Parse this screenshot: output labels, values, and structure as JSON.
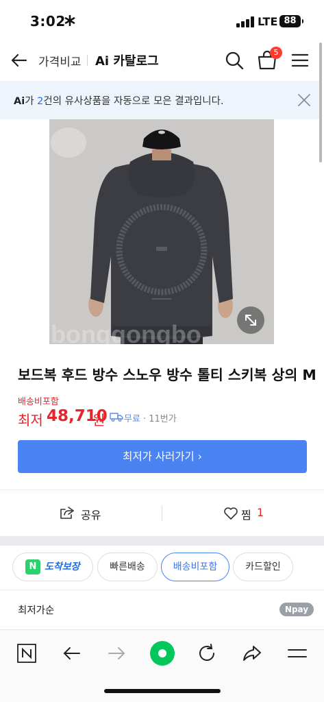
{
  "status_bar": {
    "time": "3:02",
    "network": "LTE",
    "battery": "88"
  },
  "nav": {
    "compare_label": "가격비교",
    "catalog_label": "Ai 카탈로그",
    "cart_count": "5"
  },
  "notice": {
    "ai": "Ai",
    "text_1": "가 ",
    "count": "2",
    "text_2": "건의 유사상품을 자동으로 모은 결과입니다."
  },
  "product": {
    "title": "보드복 후드 방수 스노우 방수 톨티 스키복 상의 M",
    "shipping_included": "배송비포함",
    "price_label": "최저",
    "price": "48,710",
    "price_unit": "원",
    "free_shipping": "무료",
    "seller": "· 11번가",
    "buy_button": "최저가 사러가기 ›",
    "watermark": "bonggongbo"
  },
  "actions": {
    "share": "공유",
    "zzim": "찜",
    "zzim_count": "1"
  },
  "filters": [
    {
      "label": "도착보장",
      "badge": "N",
      "active": false
    },
    {
      "label": "빠른배송",
      "active": false
    },
    {
      "label": "배송비포함",
      "active": true
    },
    {
      "label": "카드할인",
      "active": false
    }
  ],
  "sort": {
    "label": "최저가순",
    "npay": "Npay"
  },
  "colors": {
    "accent": "#4a83f2",
    "price": "#e5242b",
    "naver_green": "#03c75a"
  }
}
